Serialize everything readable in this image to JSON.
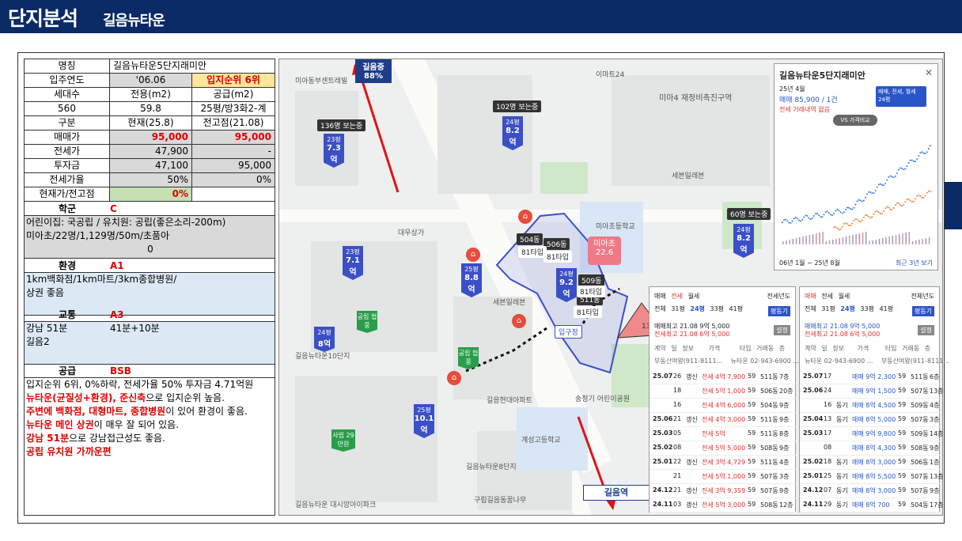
{
  "title": {
    "main": "단지분석",
    "sub": "길음뉴타운"
  },
  "info": {
    "name_label": "명칭",
    "name": "길음뉴타운5단지래미안",
    "year_label": "입주연도",
    "year": "'06.06",
    "rank": "입지순위 6위",
    "households_label": "세대수",
    "excl_label": "전용(m2)",
    "supply_label": "공급(m2)",
    "households": "560",
    "excl": "59.8",
    "supply": "25평/방3화2-계",
    "category_label": "구분",
    "current_label": "현재(25.8)",
    "prev_peak_label": "전고점(21.08)",
    "sale_label": "매매가",
    "sale_current": "95,000",
    "sale_peak": "95,000",
    "jeonse_label": "전세가",
    "jeonse_current": "47,900",
    "jeonse_peak": "-",
    "invest_label": "투자금",
    "invest_current": "47,100",
    "invest_peak": "95,000",
    "ratio_label": "전세가율",
    "ratio_current": "50%",
    "ratio_peak": "0%",
    "vs_label": "현재가/전고점",
    "vs_value": "0%"
  },
  "school": {
    "label": "학군",
    "grade": "C",
    "line1": "어린이집: 국공립 / 유치원: 공립(좋은소리-200m)",
    "line2": "미아초/22명/1,129명/50m/초품아",
    "line3": "0"
  },
  "environment": {
    "label": "환경",
    "grade": "A1",
    "line1": "1km백화점/1km마트/3km종합병원/",
    "line2": "상권 좋음"
  },
  "transport": {
    "label": "교통",
    "grade": "A3",
    "line1a": "강남 51분",
    "line1b": "41분+10분",
    "line2": "길음2"
  },
  "supply": {
    "label": "공급",
    "grade": "BSB",
    "line1": "입지순위 6위, 0%하락, 전세가율 50% 투자금 4.71억원",
    "line2a": "뉴타운(균질성+환경), 준신축",
    "line2b": "으로 입지순위 높음.",
    "line3a": "주변에 백화점, 대형마트, 종합병원",
    "line3b": "이 있어 환경이 좋음.",
    "line4a": "뉴타운 메인 상권",
    "line4b": "이 매우 잘 되어 있음.",
    "line5a": "강남 51분",
    "line5b": "으로 강남접근성도 좋음.",
    "line6": "공립 유치원 가까운편"
  },
  "map": {
    "station_top": "길음중",
    "station_top_pct": "88%",
    "station_bottom": "길음역",
    "school_pin": "미아초",
    "school_pin_sub": "22.6",
    "count_badge": "13개",
    "labels": [
      "미아4 재정비촉진구역",
      "대우상가",
      "이마트24",
      "미아초등학교",
      "세븐일레븐",
      "세븐일레븐",
      "길음현대아파트",
      "계성고등학교",
      "길음뉴타운8단지",
      "송정기 어린이공원",
      "미아동부센트레빌",
      "길음뉴타운10단지",
      "구립길음동꿈나무",
      "길음뉴타운 대시앙아이파크"
    ],
    "building_labels": [
      "504동",
      "506동",
      "509동",
      "511동",
      "81타입",
      "81타입",
      "81타입",
      "81타입",
      "입구정"
    ],
    "pins": [
      {
        "top": "23평",
        "val": "7.3억",
        "tag": "136명 보는중"
      },
      {
        "top": "24평",
        "val": "8.2억",
        "tag": "102명 보는중"
      },
      {
        "top": "23평",
        "val": "7.1억",
        "tag": ""
      },
      {
        "top": "25평",
        "val": "8.8억",
        "tag": ""
      },
      {
        "top": "24평",
        "val": "9.2억",
        "tag": ""
      },
      {
        "top": "24평",
        "val": "8.2억",
        "tag": "60명 보는중"
      },
      {
        "top": "24평",
        "val": "8억",
        "tag": ""
      },
      {
        "top": "25평",
        "val": "10.1억",
        "tag": ""
      }
    ],
    "green_pins": [
      "공립 협풍",
      "공립 협풍",
      "사립 29만원"
    ]
  },
  "chart_popup": {
    "title": "길음뉴타운5단지래미안",
    "date": "25년 4월",
    "price": "매매 85,900 / 1건",
    "no_trade": "전세 거래내역 없음",
    "compare": "VS 가격비교",
    "filter1": "매매, 전세, 월세",
    "filter2": "24평",
    "period": "06년 1월 ~ 25년 8월",
    "recent": "최근 3년 보기"
  },
  "trade_popup_left": {
    "tabs": [
      "매매",
      "전세",
      "월세"
    ],
    "sel": "전세년도",
    "sub_tabs": [
      "전체",
      "31평",
      "24평",
      "33평",
      "41평"
    ],
    "peak_sale": "매매최고 21.08 9억 5,000",
    "peak_jeonse": "전세최고 21.08 6억 5,000",
    "btn1": "평동기",
    "btn2": "설정",
    "header": [
      "계약",
      "일",
      "정보",
      "가격",
      "타입",
      "거래동",
      "층"
    ],
    "agent1": "부동산여왕(911-8111...",
    "agent2": "뉴타운 02-943-6900 ...",
    "rows": [
      [
        "25.07",
        "26",
        "갱신",
        "전세 4억 7,900",
        "59",
        "511동",
        "7층"
      ],
      [
        "",
        "18",
        "",
        "전세 5억 1,000",
        "59",
        "506동",
        "20층"
      ],
      [
        "",
        "16",
        "",
        "전세 4억 6,000",
        "59",
        "504동",
        "9층"
      ],
      [
        "25.06",
        "21",
        "갱신",
        "전세 4억 3,000",
        "59",
        "511동",
        "9층"
      ],
      [
        "25.03",
        "05",
        "",
        "전세 5억",
        "59",
        "511동",
        "8층"
      ],
      [
        "25.02",
        "08",
        "",
        "전세 5억 5,000",
        "59",
        "508동",
        "9층"
      ],
      [
        "25.01",
        "22",
        "갱신",
        "전세 3억 4,729",
        "59",
        "511동",
        "4층"
      ],
      [
        "",
        "21",
        "",
        "전세 5억 1,000",
        "59",
        "507동",
        "3층"
      ],
      [
        "24.12",
        "21",
        "갱신",
        "전세 3억 9,359",
        "59",
        "507동",
        "9층"
      ],
      [
        "24.11",
        "03",
        "갱신",
        "전세 5억 3,000",
        "59",
        "508동",
        "12층"
      ]
    ]
  },
  "trade_popup_right": {
    "tabs": [
      "매매",
      "전세",
      "월세"
    ],
    "sel": "전체년도",
    "sub_tabs": [
      "전체",
      "31평",
      "24평",
      "33평",
      "41평"
    ],
    "peak_sale": "매매최고 21.08 9억 5,000",
    "peak_jeonse": "전세최고 21.08 6억 5,000",
    "btn1": "평동기",
    "btn2": "설정",
    "header": [
      "계약",
      "일",
      "정보",
      "가격",
      "타입",
      "거래동",
      "층"
    ],
    "agent1": "뉴타운 02-943-6900 ...",
    "agent2": "부동산여왕(911-8111...",
    "rows": [
      [
        "25.07",
        "17",
        "",
        "매매 9억 2,300",
        "59",
        "511동",
        "6층"
      ],
      [
        "25.06",
        "24",
        "",
        "매매 9억 1,500",
        "59",
        "507동",
        "13층"
      ],
      [
        "",
        "16",
        "동기",
        "매매 8억 4,500",
        "59",
        "509동",
        "4층"
      ],
      [
        "25.04",
        "13",
        "동기",
        "매매 8억 5,000",
        "59",
        "507동",
        "3층"
      ],
      [
        "25.03",
        "17",
        "",
        "매매 9억 9,800",
        "59",
        "509동",
        "14층"
      ],
      [
        "",
        "08",
        "",
        "매매 8억 4,300",
        "59",
        "508동",
        "9층"
      ],
      [
        "25.02",
        "18",
        "동기",
        "매매 8억 3,000",
        "59",
        "506동",
        "1층"
      ],
      [
        "25.01",
        "25",
        "동기",
        "매매 8억 5,500",
        "59",
        "507동",
        "13층"
      ],
      [
        "24.12",
        "07",
        "동기",
        "매매 8억 3,000",
        "59",
        "507동",
        "9층"
      ],
      [
        "24.11",
        "29",
        "동기",
        "매매 8억 700",
        "59",
        "504동",
        "17층"
      ]
    ]
  }
}
